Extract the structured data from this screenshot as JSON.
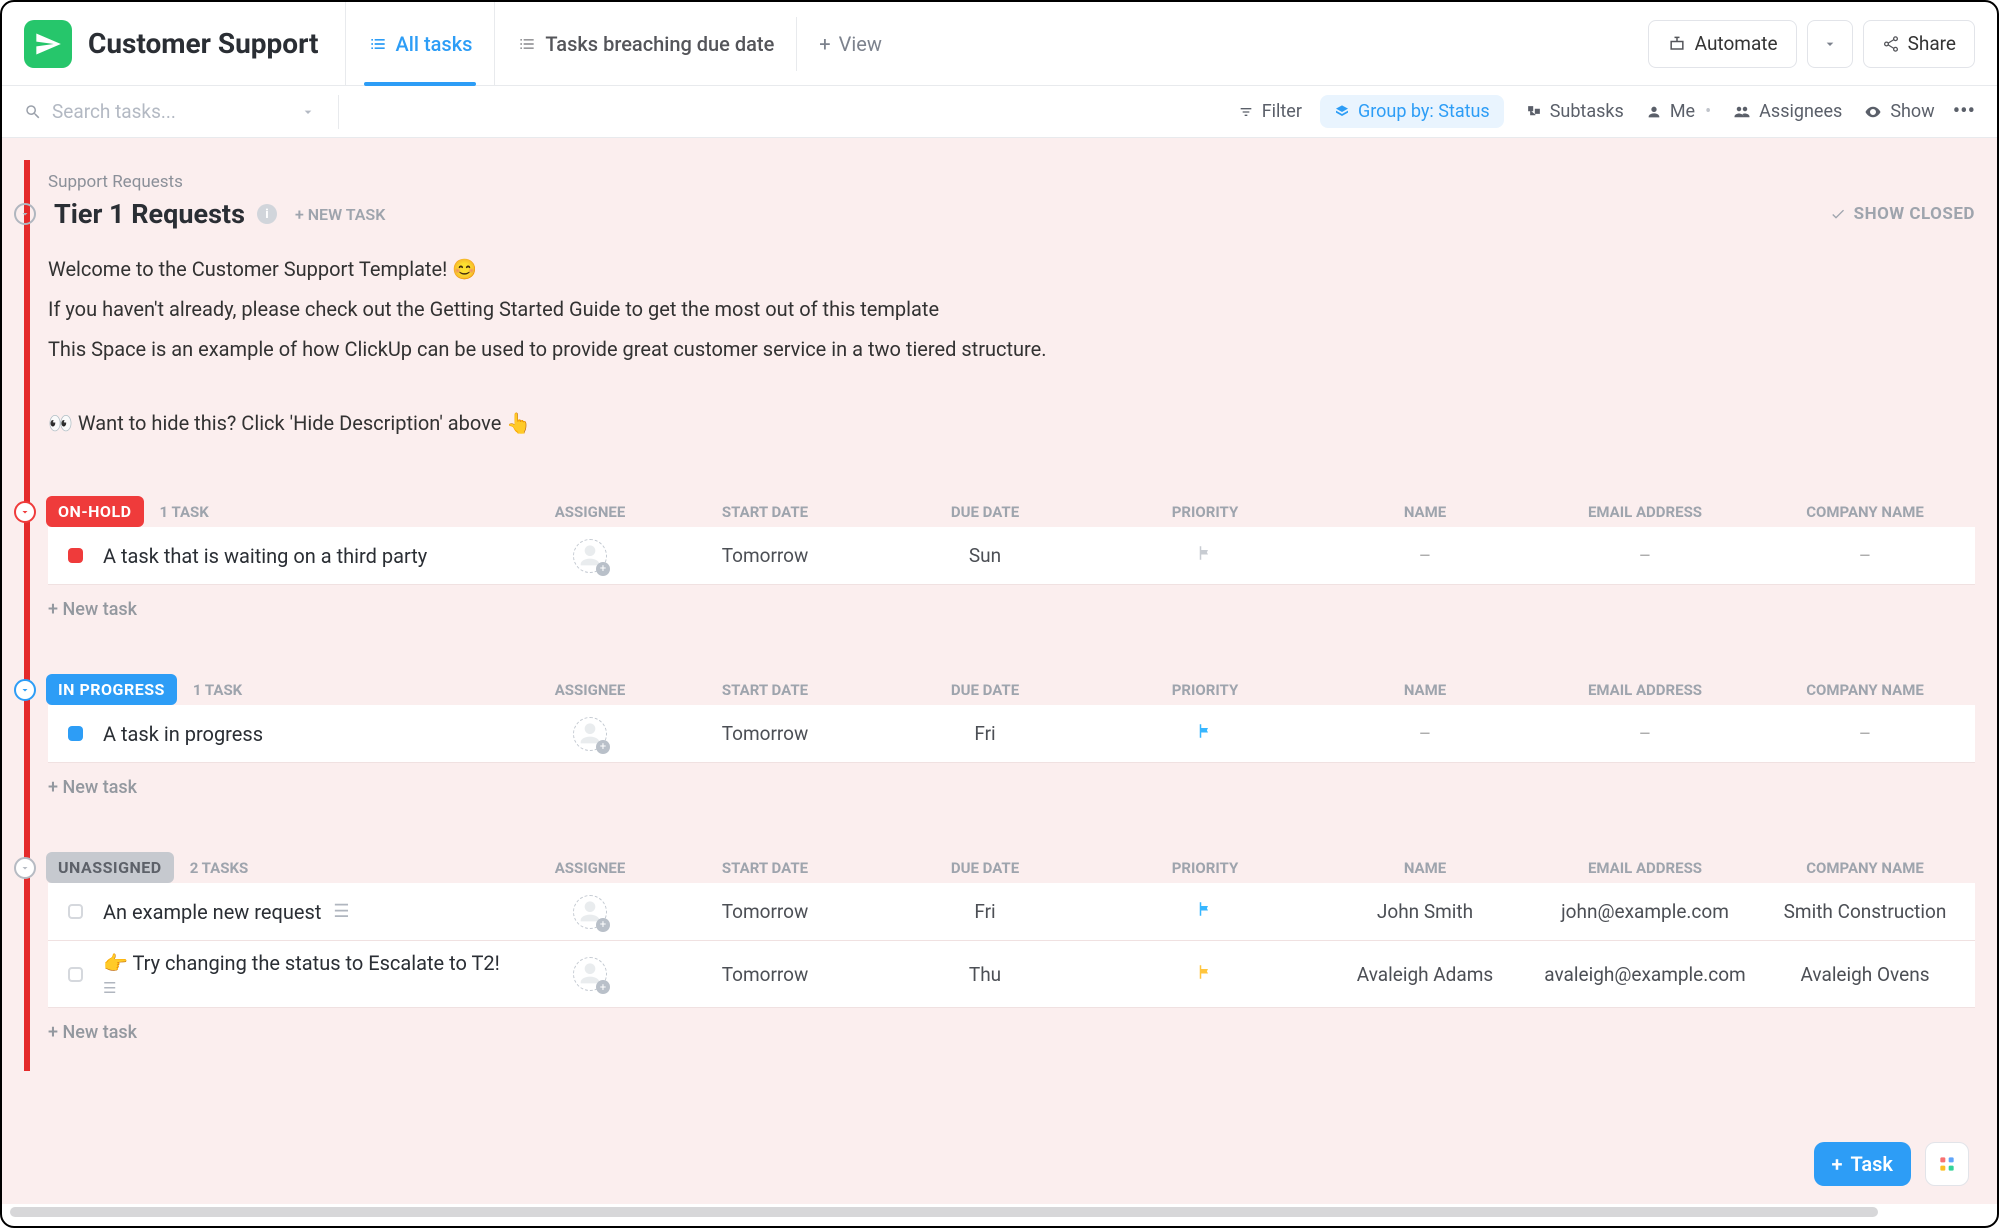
{
  "header": {
    "app_title": "Customer Support",
    "tabs": [
      {
        "label": "All tasks",
        "active": true
      },
      {
        "label": "Tasks breaching due date",
        "active": false
      }
    ],
    "add_view_label": "View",
    "automate_label": "Automate",
    "share_label": "Share"
  },
  "toolbar": {
    "search_placeholder": "Search tasks...",
    "filter": "Filter",
    "group_by": "Group by: Status",
    "subtasks": "Subtasks",
    "me": "Me",
    "assignees": "Assignees",
    "show": "Show"
  },
  "breadcrumb": "Support Requests",
  "list_title": "Tier 1 Requests",
  "new_task_label": "+ NEW TASK",
  "show_closed_label": "SHOW CLOSED",
  "description": {
    "line1": "Welcome to the Customer Support Template! 😊",
    "line2": "If you haven't already, please check out the Getting Started Guide to get the most out of this template",
    "line3": "This Space is an example of how ClickUp can be used to provide great customer service in a two tiered structure.",
    "line4": "👀  Want to hide this? Click 'Hide Description' above 👆"
  },
  "columns": {
    "assignee": "ASSIGNEE",
    "start_date": "START DATE",
    "due_date": "DUE DATE",
    "priority": "PRIORITY",
    "name": "NAME",
    "email": "EMAIL ADDRESS",
    "company": "COMPANY NAME"
  },
  "new_task_row": "+ New task",
  "groups": [
    {
      "key": "onhold",
      "label": "ON-HOLD",
      "count_label": "1 TASK",
      "chip_class": "c-onhold",
      "toggle_class": "t-onhold",
      "tasks": [
        {
          "sq": "#ef3b3b",
          "title": "A task that is waiting on a third party",
          "start_date": "Tomorrow",
          "due_date": "Sun",
          "flag": "flag-grey",
          "name": "–",
          "email": "–",
          "company": "–",
          "dash": true
        }
      ]
    },
    {
      "key": "progress",
      "label": "IN PROGRESS",
      "count_label": "1 TASK",
      "chip_class": "c-progress",
      "toggle_class": "t-progress",
      "tasks": [
        {
          "sq": "#2d9df6",
          "title": "A task in progress",
          "start_date": "Tomorrow",
          "due_date": "Fri",
          "flag": "flag-blue",
          "name": "–",
          "email": "–",
          "company": "–",
          "dash": true
        }
      ]
    },
    {
      "key": "unassigned",
      "label": "UNASSIGNED",
      "count_label": "2 TASKS",
      "chip_class": "c-unassigned",
      "toggle_class": "t-unassigned",
      "tasks": [
        {
          "sq": "#d5d8dd",
          "grey": true,
          "title": "An example new request",
          "extra_icon": true,
          "start_date": "Tomorrow",
          "due_date": "Fri",
          "flag": "flag-blue",
          "name": "John Smith",
          "email": "john@example.com",
          "company": "Smith Construction"
        },
        {
          "sq": "#d5d8dd",
          "grey": true,
          "title": "👉 Try changing the status to Escalate to T2!",
          "has_subline": true,
          "start_date": "Tomorrow",
          "due_date": "Thu",
          "flag": "flag-yellow",
          "name": "Avaleigh Adams",
          "email": "avaleigh@example.com",
          "company": "Avaleigh Ovens"
        }
      ]
    }
  ],
  "fab": {
    "task_label": "Task"
  }
}
